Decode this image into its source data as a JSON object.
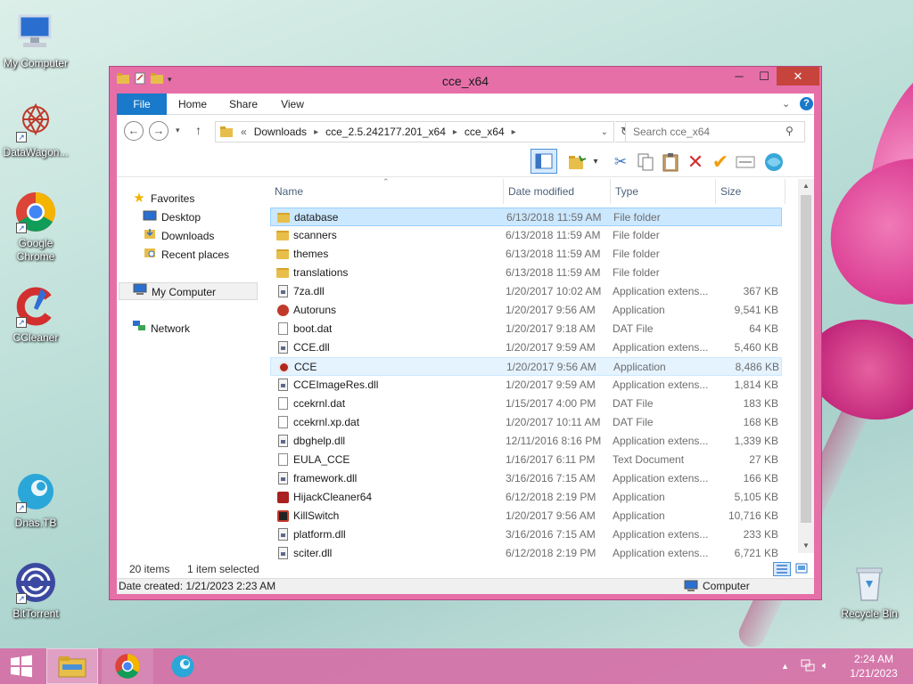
{
  "desktop": {
    "icons": [
      {
        "label": "My Computer"
      },
      {
        "label": "DataWagon..."
      },
      {
        "label": "Google Chrome"
      },
      {
        "label": "CCleaner"
      },
      {
        "label": "Dnas.TB"
      },
      {
        "label": "BitTorrent"
      },
      {
        "label": "Recycle Bin"
      }
    ]
  },
  "window": {
    "title": "cce_x64",
    "controls": {
      "minimize": "─",
      "maximize": "☐",
      "close": "✕"
    },
    "ribbon": {
      "tabs": [
        {
          "label": "File"
        },
        {
          "label": "Home"
        },
        {
          "label": "Share"
        },
        {
          "label": "View"
        }
      ],
      "expand": "⌄",
      "help": "?"
    },
    "address": {
      "prefix": "«",
      "segments": [
        "Downloads",
        "cce_2.5.242177.201_x64",
        "cce_x64"
      ],
      "search_placeholder": "Search cce_x64"
    },
    "nav": {
      "favorites": "Favorites",
      "items": [
        {
          "label": "Desktop"
        },
        {
          "label": "Downloads"
        },
        {
          "label": "Recent places"
        }
      ],
      "my_computer": "My Computer",
      "network": "Network"
    },
    "columns": {
      "name": "Name",
      "date": "Date modified",
      "type": "Type",
      "size": "Size"
    },
    "files": [
      {
        "name": "database",
        "date": "6/13/2018 11:59 AM",
        "type": "File folder",
        "size": "",
        "kind": "folder"
      },
      {
        "name": "scanners",
        "date": "6/13/2018 11:59 AM",
        "type": "File folder",
        "size": "",
        "kind": "folder"
      },
      {
        "name": "themes",
        "date": "6/13/2018 11:59 AM",
        "type": "File folder",
        "size": "",
        "kind": "folder"
      },
      {
        "name": "translations",
        "date": "6/13/2018 11:59 AM",
        "type": "File folder",
        "size": "",
        "kind": "folder"
      },
      {
        "name": "7za.dll",
        "date": "1/20/2017 10:02 AM",
        "type": "Application extens...",
        "size": "367 KB",
        "kind": "dll"
      },
      {
        "name": "Autoruns",
        "date": "1/20/2017 9:56 AM",
        "type": "Application",
        "size": "9,541 KB",
        "kind": "app-autoruns"
      },
      {
        "name": "boot.dat",
        "date": "1/20/2017 9:18 AM",
        "type": "DAT File",
        "size": "64 KB",
        "kind": "file"
      },
      {
        "name": "CCE.dll",
        "date": "1/20/2017 9:59 AM",
        "type": "Application extens...",
        "size": "5,460 KB",
        "kind": "dll"
      },
      {
        "name": "CCE",
        "date": "1/20/2017 9:56 AM",
        "type": "Application",
        "size": "8,486 KB",
        "kind": "app-cce"
      },
      {
        "name": "CCEImageRes.dll",
        "date": "1/20/2017 9:59 AM",
        "type": "Application extens...",
        "size": "1,814 KB",
        "kind": "dll"
      },
      {
        "name": "ccekrnl.dat",
        "date": "1/15/2017 4:00 PM",
        "type": "DAT File",
        "size": "183 KB",
        "kind": "file"
      },
      {
        "name": "ccekrnl.xp.dat",
        "date": "1/20/2017 10:11 AM",
        "type": "DAT File",
        "size": "168 KB",
        "kind": "file"
      },
      {
        "name": "dbghelp.dll",
        "date": "12/11/2016 8:16 PM",
        "type": "Application extens...",
        "size": "1,339 KB",
        "kind": "dll"
      },
      {
        "name": "EULA_CCE",
        "date": "1/16/2017 6:11 PM",
        "type": "Text Document",
        "size": "27 KB",
        "kind": "file"
      },
      {
        "name": "framework.dll",
        "date": "3/16/2016 7:15 AM",
        "type": "Application extens...",
        "size": "166 KB",
        "kind": "dll"
      },
      {
        "name": "HijackCleaner64",
        "date": "6/12/2018 2:19 PM",
        "type": "Application",
        "size": "5,105 KB",
        "kind": "app-hijack"
      },
      {
        "name": "KillSwitch",
        "date": "1/20/2017 9:56 AM",
        "type": "Application",
        "size": "10,716 KB",
        "kind": "app-kill"
      },
      {
        "name": "platform.dll",
        "date": "3/16/2016 7:15 AM",
        "type": "Application extens...",
        "size": "233 KB",
        "kind": "dll"
      },
      {
        "name": "sciter.dll",
        "date": "6/12/2018 2:19 PM",
        "type": "Application extens...",
        "size": "6,721 KB",
        "kind": "dll"
      }
    ],
    "status": {
      "count": "20 items",
      "selected": "1 item selected"
    },
    "details": {
      "created": "Date created: 1/21/2023 2:23 AM",
      "location": "Computer"
    }
  },
  "taskbar": {
    "time": "2:24 AM",
    "date": "1/21/2023"
  },
  "colors": {
    "window_frame": "#e66fa8",
    "file_tab": "#1979ca",
    "selection": "#cce8ff",
    "taskbar": "#d66aa4"
  }
}
